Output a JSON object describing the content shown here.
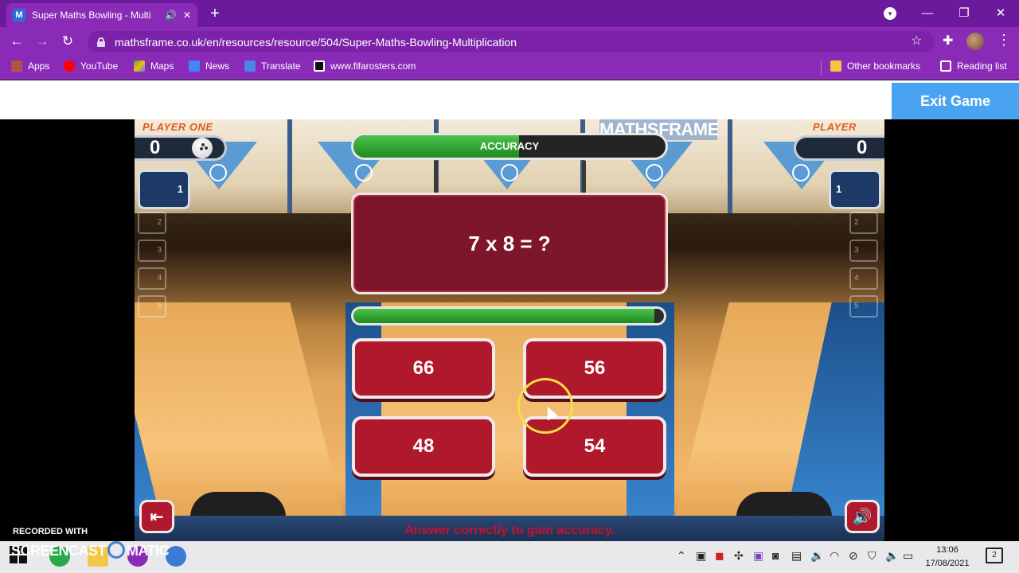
{
  "browser": {
    "tab_title": "Super Maths Bowling - Multi",
    "tab_favicon": "M",
    "url": "mathsframe.co.uk/en/resources/resource/504/Super-Maths-Bowling-Multiplication",
    "bookmarks": [
      "Apps",
      "YouTube",
      "Maps",
      "News",
      "Translate",
      "www.fifarosters.com"
    ],
    "other_bookmarks": "Other bookmarks",
    "reading_list": "Reading list",
    "accent": "#8a2bb8"
  },
  "page": {
    "exit_label": "Exit Game"
  },
  "game": {
    "logo": "MATHSFRAME",
    "player_one": {
      "label": "PLAYER ONE",
      "score": "0",
      "frame": "1"
    },
    "player_two": {
      "label": "PLAYER TWO",
      "score": "0",
      "frame": "1"
    },
    "frame_rows": [
      "2",
      "3",
      "4",
      "5"
    ],
    "accuracy_label": "ACCURACY",
    "accuracy_fraction": 0.53,
    "timer_fraction": 0.97,
    "question": "7 x 8 = ?",
    "answers": [
      "66",
      "56",
      "48",
      "54"
    ],
    "hint": "Answer correctly to gain accuracy.",
    "exit_icon": "exit-door-icon",
    "sound_icon": "speaker-icon"
  },
  "watermark": {
    "recorded_with": "RECORDED WITH",
    "brand": "SCREENCAST",
    "brand_suffix": "MATIC"
  },
  "taskbar": {
    "time": "13:06",
    "date": "17/08/2021",
    "notifications": "2"
  }
}
